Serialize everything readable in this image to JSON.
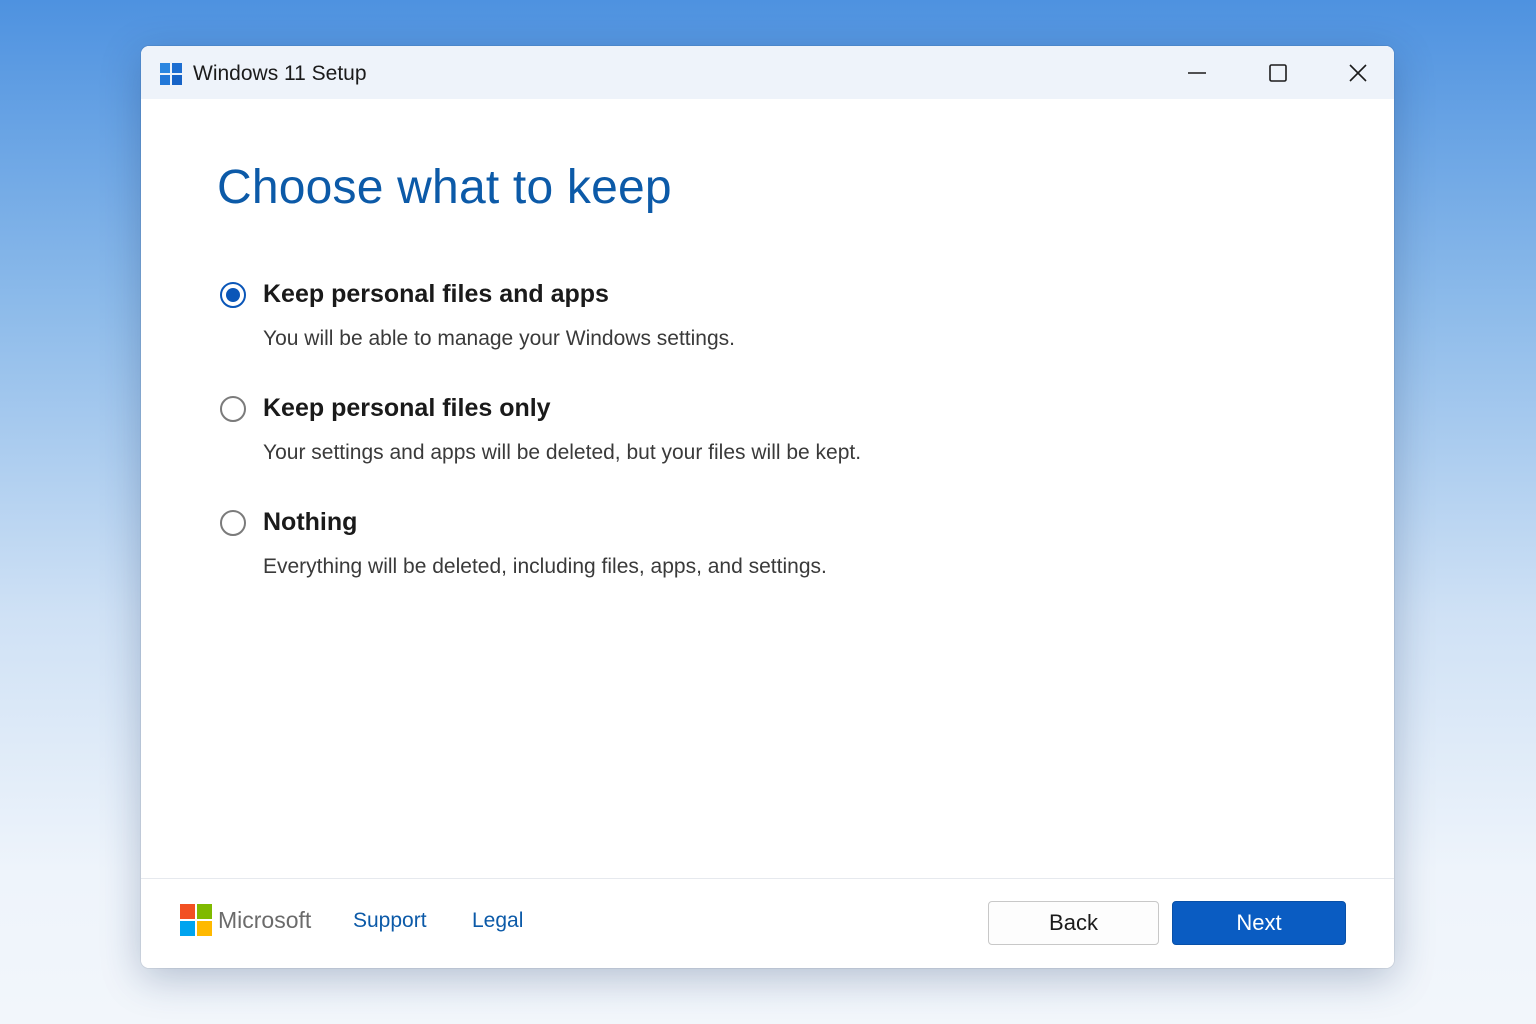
{
  "window": {
    "title": "Windows 11 Setup",
    "controls": {
      "minimize_icon": "minimize-icon",
      "maximize_icon": "maximize-icon",
      "close_icon": "close-icon"
    }
  },
  "page": {
    "heading": "Choose what to keep",
    "selected_option": 0,
    "options": [
      {
        "label": "Keep personal files and apps",
        "description": "You will be able to manage your Windows settings.",
        "checked": true
      },
      {
        "label": "Keep personal files only",
        "description": "Your settings and apps will be deleted, but your files will be kept.",
        "checked": false
      },
      {
        "label": "Nothing",
        "description": "Everything will be deleted, including files, apps, and settings.",
        "checked": false
      }
    ]
  },
  "footer": {
    "brand": "Microsoft",
    "links": {
      "support": "Support",
      "legal": "Legal"
    },
    "buttons": {
      "back": "Back",
      "next": "Next"
    }
  },
  "colors": {
    "accent": "#0a5cc2",
    "heading": "#0c5aa8",
    "titlebar": "#eef3fa"
  }
}
